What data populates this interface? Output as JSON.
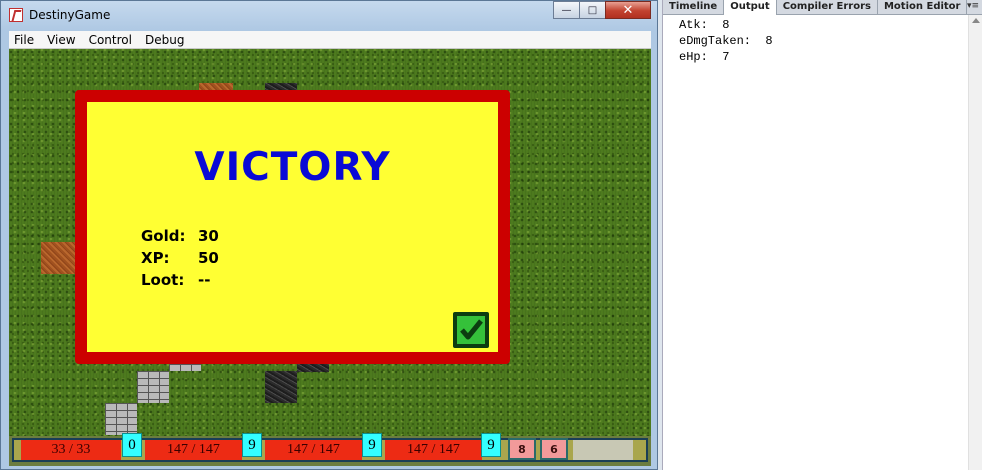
{
  "window": {
    "title": "DestinyGame",
    "controls": {
      "minimize": "—",
      "maximize": "□",
      "close": "✕"
    }
  },
  "menu": [
    "File",
    "View",
    "Control",
    "Debug"
  ],
  "victory": {
    "title": "VICTORY",
    "stats": [
      {
        "label": "Gold:",
        "value": "30"
      },
      {
        "label": "XP:",
        "value": "50"
      },
      {
        "label": "Loot:",
        "value": "--"
      }
    ]
  },
  "hud": {
    "hp": [
      "33 / 33",
      "147 / 147",
      "147 / 147",
      "147 / 147"
    ],
    "levels": [
      "0",
      "9",
      "9",
      "9"
    ],
    "buttons": [
      "8",
      "6"
    ]
  },
  "panel": {
    "tabs": [
      "Timeline",
      "Output",
      "Compiler Errors",
      "Motion Editor"
    ],
    "active_tab": "Output",
    "lines": [
      "Atk:  8",
      "eDmgTaken:  8",
      "eHp:  7"
    ]
  },
  "colors": {
    "victory_bg": "#ffff33",
    "victory_border": "#cc0000",
    "victory_title": "#0a0ad6",
    "hp_bar": "#ed2b14",
    "level_badge": "#33ffff"
  }
}
